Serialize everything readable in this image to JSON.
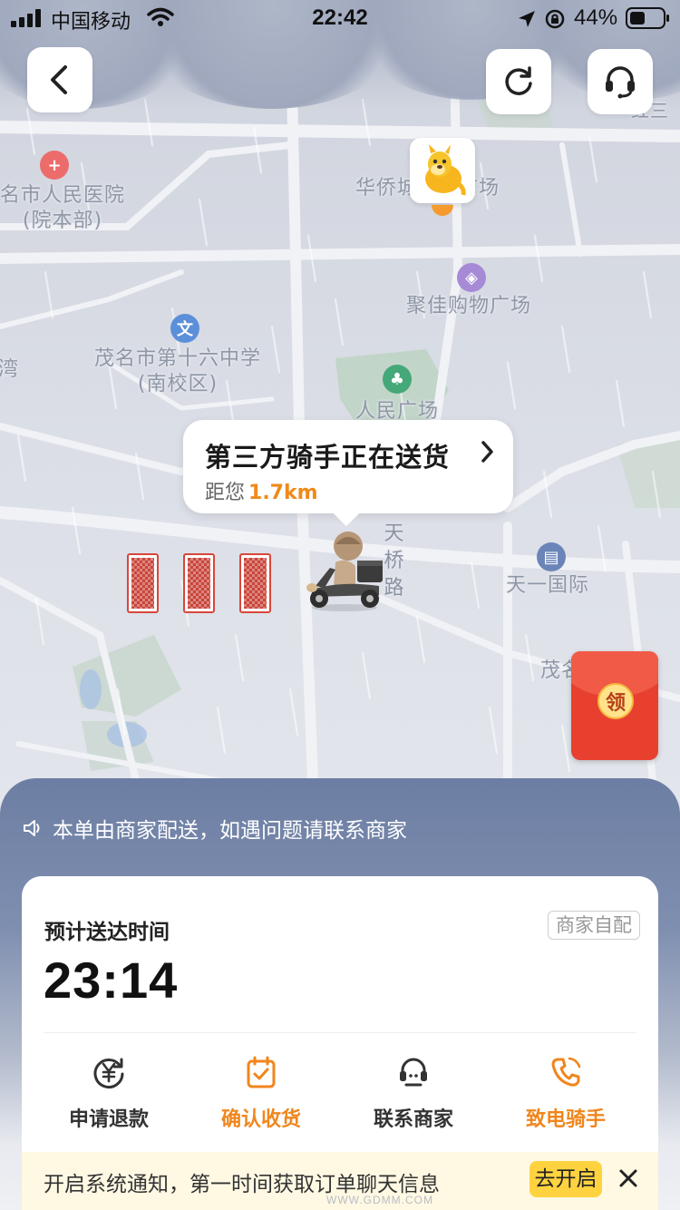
{
  "status_bar": {
    "carrier": "中国移动",
    "time": "22:42",
    "battery_percent": "44%"
  },
  "map": {
    "labels": {
      "hospital": "茂名市人民医院\n(院本部)",
      "hospital_line1": "名市人民医院",
      "hospital_line2": "(院本部)",
      "huaqiao": "华侨城",
      "huaqiao_suffix": "广场",
      "jujia": "聚佳购物广场",
      "school_line1": "茂名市第十六中学",
      "school_line2": "(南校区)",
      "wan": "湾",
      "renmin_square": "人民广场",
      "tianqiao_road": "天桥路",
      "tianyi": "天一国际",
      "mao": "茂名",
      "top_right": "红三"
    }
  },
  "rider_status": {
    "title": "第三方骑手正在送货",
    "distance_prefix": "距您",
    "distance_value": "1.7km"
  },
  "red_envelope": {
    "label": "领"
  },
  "sheet": {
    "notice": "本单由商家配送，如遇问题请联系商家",
    "eta_label": "预计送达时间",
    "eta_time": "23:14",
    "delivery_badge": "商家自配",
    "actions": [
      {
        "label": "申请退款",
        "icon": "refund-icon",
        "color": "#333333"
      },
      {
        "label": "确认收货",
        "icon": "calendar-check-icon",
        "color": "#f0861d"
      },
      {
        "label": "联系商家",
        "icon": "merchant-service-icon",
        "color": "#333333"
      },
      {
        "label": "致电骑手",
        "icon": "phone-icon",
        "color": "#f0861d"
      }
    ],
    "notification": {
      "text": "开启系统通知，第一时间获取订单聊天信息",
      "button": "去开启"
    }
  },
  "colors": {
    "accent_orange": "#f0861d",
    "sheet_blue": "#6c7ea3",
    "envelope_red": "#e8402f",
    "notif_yellow": "#ffd33f"
  },
  "watermark": "WWW.GDMM.COM"
}
